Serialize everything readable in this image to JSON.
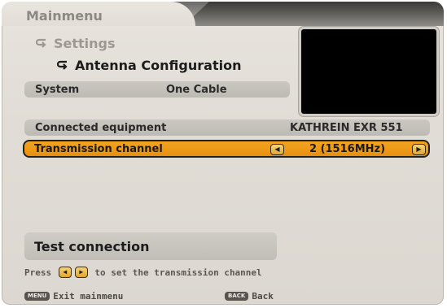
{
  "header": {
    "title": "Mainmenu"
  },
  "breadcrumb": {
    "settings": "Settings",
    "current": "Antenna Configuration"
  },
  "rows": {
    "system": {
      "label": "System",
      "value": "One Cable"
    },
    "connected": {
      "label": "Connected equipment",
      "value": "KATHREIN EXR 551"
    },
    "transmission": {
      "label": "Transmission channel",
      "value": "2 (1516MHz)"
    }
  },
  "test_button": {
    "label": "Test connection"
  },
  "hint": {
    "prefix": "Press",
    "suffix": "to set the transmission channel"
  },
  "footer": {
    "menu_key": "MENU",
    "menu_label": "Exit mainmenu",
    "back_key": "BACK",
    "back_label": "Back"
  },
  "icons": {
    "arrow": "arrow-return-icon",
    "left": "left-arrow-icon",
    "right": "right-arrow-icon"
  },
  "colors": {
    "highlight": "#ee9b18",
    "background": "#e1ddd6",
    "preview": "#000000"
  }
}
